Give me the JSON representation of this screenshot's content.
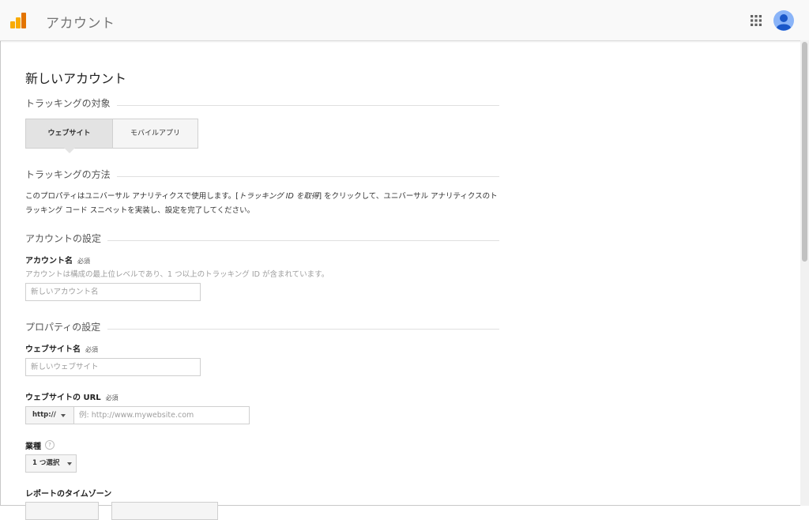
{
  "header": {
    "title": "アカウント",
    "logo_icon": "analytics-logo",
    "apps_icon": "apps-grid-icon",
    "avatar_icon": "account-avatar-icon",
    "colors": {
      "logo_orange": "#F9AB00",
      "logo_dark_orange": "#E37400",
      "avatar_blue": "#4285F4"
    }
  },
  "page_title": "新しいアカウント",
  "tracking_target": {
    "heading": "トラッキングの対象",
    "options": [
      {
        "label": "ウェブサイト",
        "active": true
      },
      {
        "label": "モバイルアプリ",
        "active": false
      }
    ]
  },
  "tracking_method": {
    "heading": "トラッキングの方法",
    "desc_part1": "このプロパティはユニバーサル アナリティクスで使用します。[",
    "desc_link": "トラッキング ID を取得",
    "desc_part2": "] をクリックして、ユニバーサル アナリティクスのトラッキング コード スニペットを実装し、設定を完了してください。"
  },
  "account_settings": {
    "heading": "アカウントの設定",
    "account_name_label": "アカウント名",
    "required": "必須",
    "account_name_help": "アカウントは構成の最上位レベルであり、1 つ以上のトラッキング ID が含まれています。",
    "account_name_placeholder": "新しいアカウント名"
  },
  "property_settings": {
    "heading": "プロパティの設定",
    "website_name_label": "ウェブサイト名",
    "required": "必須",
    "website_name_placeholder": "新しいウェブサイト",
    "url_label": "ウェブサイトの URL",
    "url_protocol": "http://",
    "url_placeholder": "例: http://www.mywebsite.com",
    "industry_label": "業種",
    "industry_help_icon": "?",
    "industry_select": "1 つ選択",
    "timezone_label": "レポートのタイムゾーン"
  }
}
